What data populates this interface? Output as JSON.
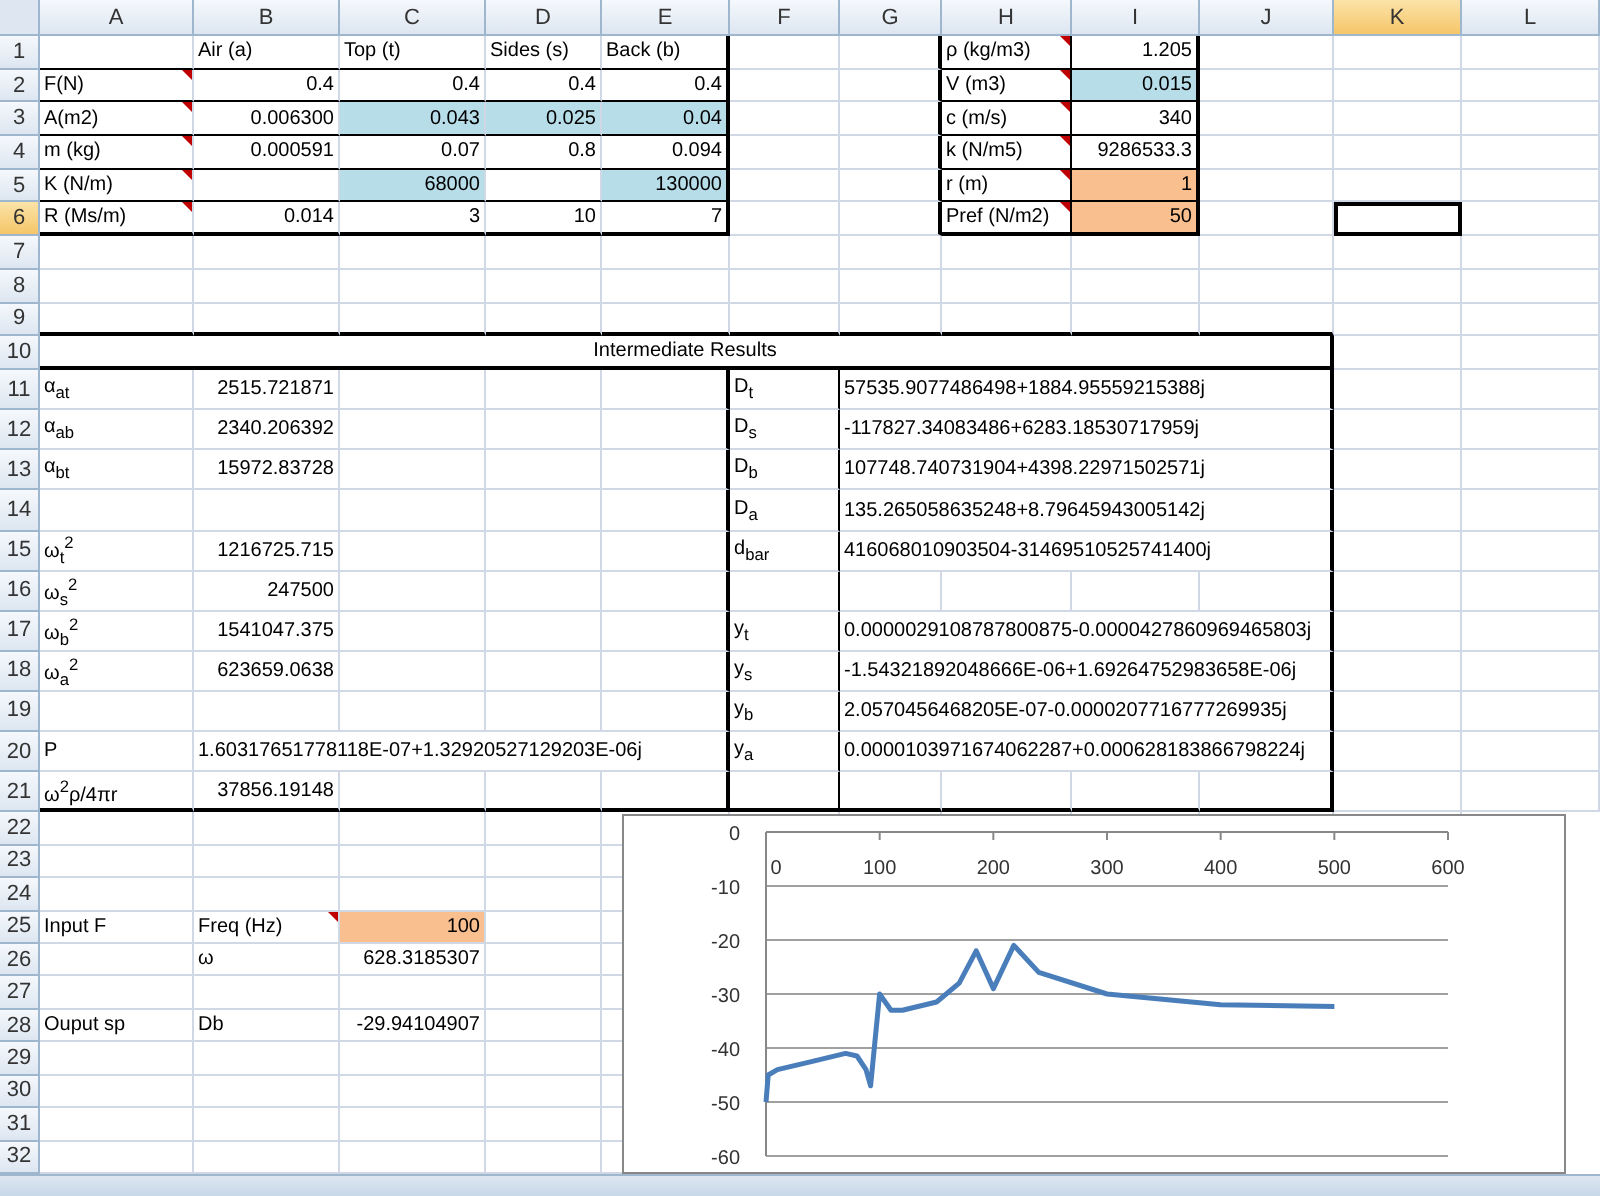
{
  "columns": [
    {
      "label": "A",
      "selected": false
    },
    {
      "label": "B",
      "selected": false
    },
    {
      "label": "C",
      "selected": false
    },
    {
      "label": "D",
      "selected": false
    },
    {
      "label": "E",
      "selected": false
    },
    {
      "label": "F",
      "selected": false
    },
    {
      "label": "G",
      "selected": false
    },
    {
      "label": "H",
      "selected": false
    },
    {
      "label": "I",
      "selected": false
    },
    {
      "label": "J",
      "selected": false
    },
    {
      "label": "K",
      "selected": true
    },
    {
      "label": "L",
      "selected": false
    }
  ],
  "rows": [
    {
      "label": "1",
      "selected": false,
      "cells": [
        null,
        {
          "text": "Air (a)",
          "kind": "text",
          "comment": false
        },
        {
          "text": "Top (t)",
          "kind": "text",
          "comment": false
        },
        {
          "text": "Sides (s)",
          "kind": "text",
          "comment": false
        },
        {
          "text": "Back (b)",
          "kind": "text",
          "comment": false
        },
        null,
        null,
        {
          "text": "ρ (kg/m3)",
          "kind": "text",
          "comment": true
        },
        {
          "text": "1.205",
          "kind": "number",
          "comment": false
        }
      ]
    },
    {
      "label": "2",
      "selected": false,
      "cells": [
        {
          "text": "F(N)",
          "kind": "text",
          "comment": true
        },
        {
          "text": "0.4",
          "kind": "number",
          "comment": false
        },
        {
          "text": "0.4",
          "kind": "number",
          "comment": false
        },
        {
          "text": "0.4",
          "kind": "number",
          "comment": false
        },
        {
          "text": "0.4",
          "kind": "number",
          "comment": false
        },
        null,
        null,
        {
          "text": "V (m3)",
          "kind": "text",
          "comment": true
        },
        {
          "text": "0.015",
          "kind": "number",
          "comment": false,
          "color": "#b7dde8"
        }
      ]
    },
    {
      "label": "3",
      "selected": false,
      "cells": [
        {
          "text": "A(m2)",
          "kind": "text",
          "comment": true
        },
        {
          "text": "0.006300",
          "kind": "number",
          "comment": false
        },
        {
          "text": "0.043",
          "kind": "number",
          "comment": false,
          "color": "#b7dde8"
        },
        {
          "text": "0.025",
          "kind": "number",
          "comment": false,
          "color": "#b7dde8"
        },
        {
          "text": "0.04",
          "kind": "number",
          "comment": false,
          "color": "#b7dde8"
        },
        null,
        null,
        {
          "text": "c (m/s)",
          "kind": "text",
          "comment": true
        },
        {
          "text": "340",
          "kind": "number",
          "comment": false
        }
      ]
    },
    {
      "label": "4",
      "selected": false,
      "cells": [
        {
          "text": "m (kg)",
          "kind": "text",
          "comment": true
        },
        {
          "text": "0.000591",
          "kind": "number",
          "comment": false
        },
        {
          "text": "0.07",
          "kind": "number",
          "comment": false
        },
        {
          "text": "0.8",
          "kind": "number",
          "comment": false
        },
        {
          "text": "0.094",
          "kind": "number",
          "comment": false
        },
        null,
        null,
        {
          "text": "k (N/m5)",
          "kind": "text",
          "comment": true
        },
        {
          "text": "9286533.3",
          "kind": "number",
          "comment": false
        }
      ]
    },
    {
      "label": "5",
      "selected": false,
      "cells": [
        {
          "text": "K (N/m)",
          "kind": "text",
          "comment": true
        },
        null,
        {
          "text": "68000",
          "kind": "number",
          "comment": false,
          "color": "#b7dde8"
        },
        null,
        {
          "text": "130000",
          "kind": "number",
          "comment": false,
          "color": "#b7dde8"
        },
        null,
        null,
        {
          "text": "r (m)",
          "kind": "text",
          "comment": true
        },
        {
          "text": "1",
          "kind": "number",
          "comment": false,
          "color": "#fabf8f"
        }
      ]
    },
    {
      "label": "6",
      "selected": true,
      "cells": [
        {
          "text": "R (Ms/m)",
          "kind": "text",
          "comment": true
        },
        {
          "text": "0.014",
          "kind": "number",
          "comment": false
        },
        {
          "text": "3",
          "kind": "number",
          "comment": false
        },
        {
          "text": "10",
          "kind": "number",
          "comment": false
        },
        {
          "text": "7",
          "kind": "number",
          "comment": false
        },
        null,
        null,
        {
          "text": "Pref (N/m2)",
          "kind": "text",
          "comment": true
        },
        {
          "text": "50",
          "kind": "number",
          "comment": false,
          "color": "#fabf8f"
        }
      ]
    },
    {
      "label": "7",
      "selected": false
    },
    {
      "label": "8",
      "selected": false
    },
    {
      "label": "9",
      "selected": false
    },
    {
      "label": "10",
      "selected": false,
      "cells": [
        {
          "text": "Intermediate Results",
          "kind": "title",
          "comment": false
        },
        null,
        null,
        null,
        null,
        null,
        null,
        null,
        null,
        null
      ]
    },
    {
      "label": "11",
      "selected": false,
      "cells": [
        {
          "text": "α$_{at}$",
          "kind": "text",
          "comment": false
        },
        {
          "text": "2515.721871",
          "kind": "number",
          "comment": false
        },
        null,
        null,
        null,
        {
          "text": "D$_{t}$",
          "kind": "text",
          "comment": false
        },
        {
          "text": "57535.9077486498+1884.95559215388j",
          "kind": "overflow",
          "comment": false
        },
        null,
        null,
        null
      ]
    },
    {
      "label": "12",
      "selected": false,
      "cells": [
        {
          "text": "α$_{ab}$",
          "kind": "text",
          "comment": false
        },
        {
          "text": "2340.206392",
          "kind": "number",
          "comment": false
        },
        null,
        null,
        null,
        {
          "text": "D$_{s}$",
          "kind": "text",
          "comment": false
        },
        {
          "text": "-117827.34083486+6283.18530717959j",
          "kind": "overflow",
          "comment": false
        },
        null,
        null,
        null
      ]
    },
    {
      "label": "13",
      "selected": false,
      "cells": [
        {
          "text": "α$_{bt}$",
          "kind": "text",
          "comment": false
        },
        {
          "text": "15972.83728",
          "kind": "number",
          "comment": false
        },
        null,
        null,
        null,
        {
          "text": "D$_{b}$",
          "kind": "text",
          "comment": false
        },
        {
          "text": "107748.740731904+4398.22971502571j",
          "kind": "overflow",
          "comment": false
        },
        null,
        null,
        null
      ]
    },
    {
      "label": "14",
      "selected": false,
      "cells": [
        null,
        null,
        null,
        null,
        null,
        {
          "text": "D$_{a}$",
          "kind": "text",
          "comment": false
        },
        {
          "text": "135.265058635248+8.79645943005142j",
          "kind": "overflow",
          "comment": false
        },
        null,
        null,
        null
      ]
    },
    {
      "label": "15",
      "selected": false,
      "cells": [
        {
          "text": "ω$_{t}$$^{2}$",
          "kind": "text",
          "comment": false
        },
        {
          "text": "1216725.715",
          "kind": "number",
          "comment": false
        },
        null,
        null,
        null,
        {
          "text": "d$_{bar}$",
          "kind": "text",
          "comment": false
        },
        {
          "text": "416068010903504-31469510525741400j",
          "kind": "overflow",
          "comment": false
        },
        null,
        null,
        null
      ]
    },
    {
      "label": "16",
      "selected": false,
      "cells": [
        {
          "text": "ω$_{s}$$^{2}$",
          "kind": "text",
          "comment": false
        },
        {
          "text": "247500",
          "kind": "number",
          "comment": false
        }
      ]
    },
    {
      "label": "17",
      "selected": false,
      "cells": [
        {
          "text": "ω$_{b}$$^{2}$",
          "kind": "text",
          "comment": false
        },
        {
          "text": "1541047.375",
          "kind": "number",
          "comment": false
        },
        null,
        null,
        null,
        {
          "text": "y$_{t}$",
          "kind": "text",
          "comment": false
        },
        {
          "text": "0.0000029108787800875-0.0000427860969465803j",
          "kind": "overflow",
          "comment": false
        },
        null,
        null,
        null
      ]
    },
    {
      "label": "18",
      "selected": false,
      "cells": [
        {
          "text": "ω$_{a}$$^{2}$",
          "kind": "text",
          "comment": false
        },
        {
          "text": "623659.0638",
          "kind": "number",
          "comment": false
        },
        null,
        null,
        null,
        {
          "text": "y$_{s}$",
          "kind": "text",
          "comment": false
        },
        {
          "text": "-1.54321892048666E-06+1.69264752983658E-06j",
          "kind": "overflow",
          "comment": false
        },
        null,
        null,
        null
      ]
    },
    {
      "label": "19",
      "selected": false,
      "cells": [
        null,
        null,
        null,
        null,
        null,
        {
          "text": "y$_{b}$",
          "kind": "text",
          "comment": false
        },
        {
          "text": "2.0570456468205E-07-0.0000207716777269935j",
          "kind": "overflow",
          "comment": false
        },
        null,
        null,
        null
      ]
    },
    {
      "label": "20",
      "selected": false,
      "cells": [
        {
          "text": "P",
          "kind": "text",
          "comment": false
        },
        {
          "text": "1.60317651778118E-07+1.32920527129203E-06j",
          "kind": "overflow",
          "comment": false
        },
        null,
        null,
        null,
        {
          "text": "y$_{a}$",
          "kind": "text",
          "comment": false
        },
        {
          "text": "0.0000103971674062287+0.000628183866798224j",
          "kind": "overflow",
          "comment": false
        },
        null,
        null,
        null
      ]
    },
    {
      "label": "21",
      "selected": false,
      "cells": [
        {
          "text": "ω$^{2}$ρ/4πr",
          "kind": "text",
          "comment": false
        },
        {
          "text": "37856.19148",
          "kind": "number",
          "comment": false
        }
      ]
    },
    {
      "label": "22",
      "selected": false
    },
    {
      "label": "23",
      "selected": false
    },
    {
      "label": "24",
      "selected": false
    },
    {
      "label": "25",
      "selected": false,
      "cells": [
        {
          "text": "Input F",
          "kind": "text",
          "comment": false
        },
        {
          "text": "Freq (Hz)",
          "kind": "text",
          "comment": true
        },
        {
          "text": "100",
          "kind": "number",
          "comment": false,
          "color": "#fabf8f"
        }
      ]
    },
    {
      "label": "26",
      "selected": false,
      "cells": [
        null,
        {
          "text": "ω",
          "kind": "text",
          "comment": false
        },
        {
          "text": "628.3185307",
          "kind": "number",
          "comment": false
        }
      ]
    },
    {
      "label": "27",
      "selected": false
    },
    {
      "label": "28",
      "selected": false,
      "cells": [
        {
          "text": "Ouput sp",
          "kind": "text",
          "comment": false
        },
        {
          "text": "Db",
          "kind": "text",
          "comment": false
        },
        {
          "text": "-29.94104907",
          "kind": "number",
          "comment": false
        }
      ]
    },
    {
      "label": "29",
      "selected": false
    },
    {
      "label": "30",
      "selected": false
    },
    {
      "label": "31",
      "selected": false
    },
    {
      "label": "32",
      "selected": false
    }
  ],
  "chart": {
    "chart_data": {
      "type": "line",
      "x": [
        0,
        2,
        10,
        40,
        70,
        80,
        88,
        92,
        100,
        110,
        120,
        150,
        170,
        185,
        200,
        218,
        240,
        300,
        400,
        500
      ],
      "series": [
        {
          "color": "#4a7ebb",
          "values": [
            -50,
            -45,
            -44,
            -42.5,
            -41,
            -41.5,
            -44,
            -47,
            -30,
            -33,
            -33,
            -31.5,
            -28,
            -22,
            -29,
            -21,
            -26,
            -30,
            -32,
            -32.3
          ]
        }
      ],
      "grid": true,
      "xlim": [
        0,
        600
      ],
      "ylim": [
        -60,
        0
      ],
      "xticks": [
        0,
        100,
        200,
        300,
        400,
        500,
        600
      ],
      "yticks": [
        0,
        -10,
        -20,
        -30,
        -40,
        -50,
        -60
      ]
    }
  }
}
